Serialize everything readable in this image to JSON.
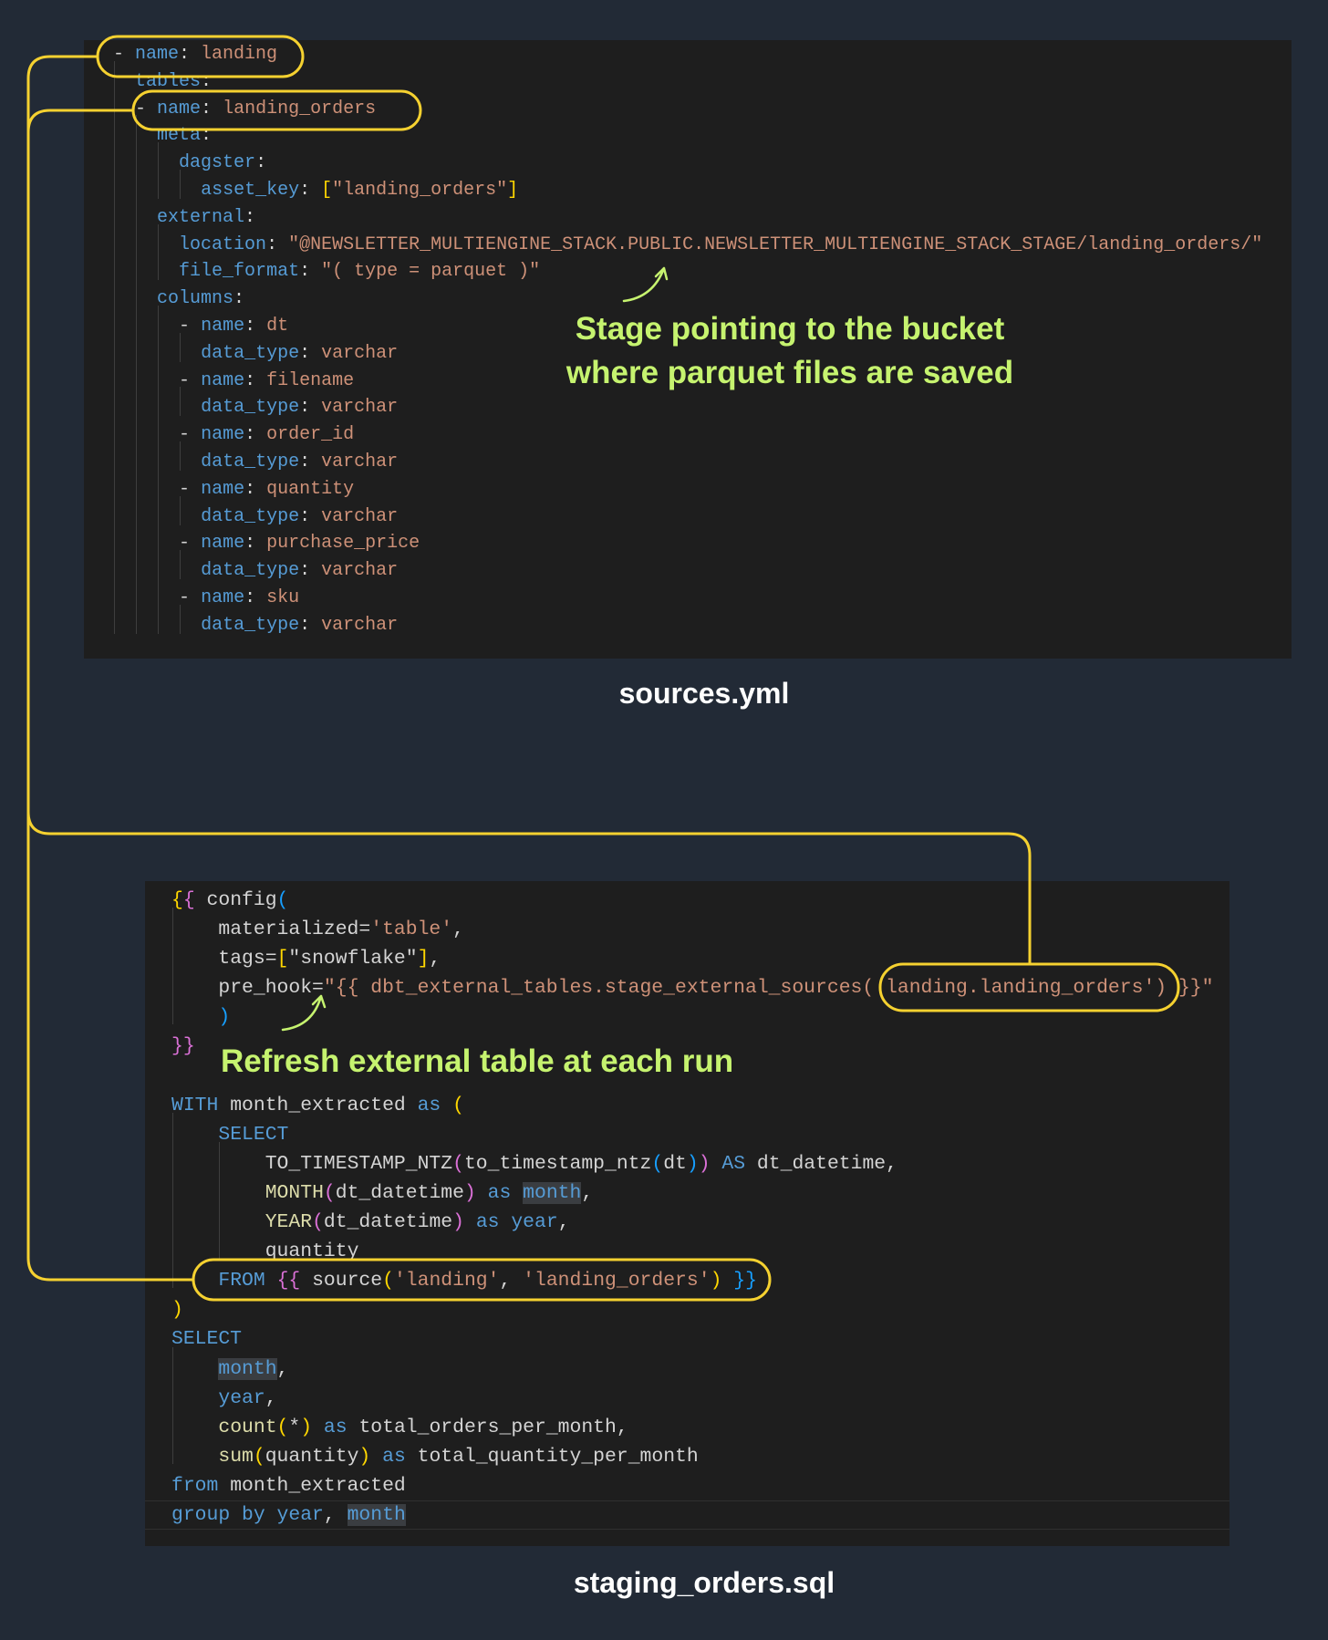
{
  "sources_yml": {
    "caption": "sources.yml",
    "annotation_line1": "Stage pointing to the bucket",
    "annotation_line2": "where parquet files are saved",
    "lines": [
      {
        "indent": 0,
        "t": [
          [
            "- ",
            "w"
          ],
          [
            "name",
            "k"
          ],
          [
            ": ",
            "w"
          ],
          [
            "landing",
            "s"
          ]
        ]
      },
      {
        "indent": 2,
        "t": [
          [
            "tables",
            "k"
          ],
          [
            ":",
            "w"
          ]
        ]
      },
      {
        "indent": 2,
        "t": [
          [
            "- ",
            "w"
          ],
          [
            "name",
            "k"
          ],
          [
            ": ",
            "w"
          ],
          [
            "landing_orders",
            "s"
          ]
        ]
      },
      {
        "indent": 4,
        "t": [
          [
            "meta",
            "k"
          ],
          [
            ":",
            "w"
          ]
        ]
      },
      {
        "indent": 6,
        "t": [
          [
            "dagster",
            "k"
          ],
          [
            ":",
            "w"
          ]
        ]
      },
      {
        "indent": 8,
        "t": [
          [
            "asset_key",
            "k"
          ],
          [
            ": ",
            "w"
          ],
          [
            "[",
            "y"
          ],
          [
            "\"landing_orders\"",
            "s"
          ],
          [
            "]",
            "y"
          ]
        ]
      },
      {
        "indent": 4,
        "t": [
          [
            "external",
            "k"
          ],
          [
            ":",
            "w"
          ]
        ]
      },
      {
        "indent": 6,
        "t": [
          [
            "location",
            "k"
          ],
          [
            ": ",
            "w"
          ],
          [
            "\"@NEWSLETTER_MULTIENGINE_STACK.PUBLIC.NEWSLETTER_MULTIENGINE_STACK_STAGE/landing_orders/\"",
            "s"
          ]
        ]
      },
      {
        "indent": 6,
        "t": [
          [
            "file_format",
            "k"
          ],
          [
            ": ",
            "w"
          ],
          [
            "\"( type = parquet )\"",
            "s"
          ]
        ]
      },
      {
        "indent": 4,
        "t": [
          [
            "columns",
            "k"
          ],
          [
            ":",
            "w"
          ]
        ]
      },
      {
        "indent": 6,
        "t": [
          [
            "- ",
            "w"
          ],
          [
            "name",
            "k"
          ],
          [
            ": ",
            "w"
          ],
          [
            "dt",
            "s"
          ]
        ]
      },
      {
        "indent": 8,
        "t": [
          [
            "data_type",
            "k"
          ],
          [
            ": ",
            "w"
          ],
          [
            "varchar",
            "s"
          ]
        ]
      },
      {
        "indent": 6,
        "t": [
          [
            "- ",
            "w"
          ],
          [
            "name",
            "k"
          ],
          [
            ": ",
            "w"
          ],
          [
            "filename",
            "s"
          ]
        ]
      },
      {
        "indent": 8,
        "t": [
          [
            "data_type",
            "k"
          ],
          [
            ": ",
            "w"
          ],
          [
            "varchar",
            "s"
          ]
        ]
      },
      {
        "indent": 6,
        "t": [
          [
            "- ",
            "w"
          ],
          [
            "name",
            "k"
          ],
          [
            ": ",
            "w"
          ],
          [
            "order_id",
            "s"
          ]
        ]
      },
      {
        "indent": 8,
        "t": [
          [
            "data_type",
            "k"
          ],
          [
            ": ",
            "w"
          ],
          [
            "varchar",
            "s"
          ]
        ]
      },
      {
        "indent": 6,
        "t": [
          [
            "- ",
            "w"
          ],
          [
            "name",
            "k"
          ],
          [
            ": ",
            "w"
          ],
          [
            "quantity",
            "s"
          ]
        ]
      },
      {
        "indent": 8,
        "t": [
          [
            "data_type",
            "k"
          ],
          [
            ": ",
            "w"
          ],
          [
            "varchar",
            "s"
          ]
        ]
      },
      {
        "indent": 6,
        "t": [
          [
            "- ",
            "w"
          ],
          [
            "name",
            "k"
          ],
          [
            ": ",
            "w"
          ],
          [
            "purchase_price",
            "s"
          ]
        ]
      },
      {
        "indent": 8,
        "t": [
          [
            "data_type",
            "k"
          ],
          [
            ": ",
            "w"
          ],
          [
            "varchar",
            "s"
          ]
        ]
      },
      {
        "indent": 6,
        "t": [
          [
            "- ",
            "w"
          ],
          [
            "name",
            "k"
          ],
          [
            ": ",
            "w"
          ],
          [
            "sku",
            "s"
          ]
        ]
      },
      {
        "indent": 8,
        "t": [
          [
            "data_type",
            "k"
          ],
          [
            ": ",
            "w"
          ],
          [
            "varchar",
            "s"
          ]
        ]
      }
    ]
  },
  "staging_orders_sql": {
    "caption": "staging_orders.sql",
    "annotation": "Refresh external table at each run",
    "lines": [
      {
        "indent": 0,
        "t": [
          [
            "{",
            "y"
          ],
          [
            "{",
            "p"
          ],
          [
            " config",
            "w"
          ],
          [
            "(",
            "b"
          ]
        ]
      },
      {
        "indent": 4,
        "t": [
          [
            "materialized=",
            "w"
          ],
          [
            "'table'",
            "s"
          ],
          [
            ",",
            "w"
          ]
        ]
      },
      {
        "indent": 4,
        "t": [
          [
            "tags=",
            "w"
          ],
          [
            "[",
            "y"
          ],
          [
            "\"snowflake\"",
            "w"
          ],
          [
            "]",
            "y"
          ],
          [
            ",",
            "w"
          ]
        ]
      },
      {
        "indent": 4,
        "t": [
          [
            "pre_hook=",
            "w"
          ],
          [
            "\"{{ dbt_external_tables.stage_external_sources( landing.landing_orders') }}\"",
            "s"
          ]
        ]
      },
      {
        "indent": 4,
        "t": [
          [
            ")",
            "b"
          ]
        ]
      },
      {
        "indent": 0,
        "t": [
          [
            "}}",
            "p"
          ]
        ]
      },
      {
        "indent": 0,
        "t": []
      },
      {
        "indent": 0,
        "t": [
          [
            "WITH",
            "k"
          ],
          [
            " month_extracted ",
            "w"
          ],
          [
            "as",
            "k"
          ],
          [
            " ",
            "w"
          ],
          [
            "(",
            "y"
          ]
        ]
      },
      {
        "indent": 4,
        "t": [
          [
            "SELECT",
            "k"
          ]
        ]
      },
      {
        "indent": 8,
        "t": [
          [
            "TO_TIMESTAMP_NTZ",
            "w"
          ],
          [
            "(",
            "p"
          ],
          [
            "to_timestamp_ntz",
            "w"
          ],
          [
            "(",
            "b"
          ],
          [
            "dt",
            "w"
          ],
          [
            ")",
            "b"
          ],
          [
            ")",
            "p"
          ],
          [
            " ",
            "w"
          ],
          [
            "AS",
            "k"
          ],
          [
            " dt_datetime,",
            "w"
          ]
        ]
      },
      {
        "indent": 8,
        "t": [
          [
            "MONTH",
            "f"
          ],
          [
            "(",
            "p"
          ],
          [
            "dt_datetime",
            "w"
          ],
          [
            ")",
            "p"
          ],
          [
            " ",
            "w"
          ],
          [
            "as",
            "k"
          ],
          [
            " ",
            "w"
          ],
          [
            "month",
            "sel"
          ],
          [
            ",",
            "w"
          ]
        ]
      },
      {
        "indent": 8,
        "t": [
          [
            "YEAR",
            "f"
          ],
          [
            "(",
            "p"
          ],
          [
            "dt_datetime",
            "w"
          ],
          [
            ")",
            "p"
          ],
          [
            " ",
            "w"
          ],
          [
            "as",
            "k"
          ],
          [
            " ",
            "w"
          ],
          [
            "year",
            "k"
          ],
          [
            ",",
            "w"
          ]
        ]
      },
      {
        "indent": 8,
        "t": [
          [
            "quantity",
            "w"
          ]
        ]
      },
      {
        "indent": 4,
        "t": [
          [
            "FROM",
            "k"
          ],
          [
            " ",
            "w"
          ],
          [
            "{{",
            "p"
          ],
          [
            " source",
            "w"
          ],
          [
            "(",
            "y"
          ],
          [
            "'landing'",
            "s"
          ],
          [
            ", ",
            "w"
          ],
          [
            "'landing_orders'",
            "s"
          ],
          [
            ")",
            "y"
          ],
          [
            " ",
            "w"
          ],
          [
            "}}",
            "b"
          ]
        ]
      },
      {
        "indent": 0,
        "t": [
          [
            ")",
            "y"
          ]
        ]
      },
      {
        "indent": 0,
        "t": [
          [
            "SELECT",
            "k"
          ]
        ]
      },
      {
        "indent": 4,
        "t": [
          [
            "month",
            "sel"
          ],
          [
            ",",
            "w"
          ]
        ]
      },
      {
        "indent": 4,
        "t": [
          [
            "year",
            "k"
          ],
          [
            ",",
            "w"
          ]
        ]
      },
      {
        "indent": 4,
        "t": [
          [
            "count",
            "f"
          ],
          [
            "(",
            "y"
          ],
          [
            "*",
            "w"
          ],
          [
            ")",
            "y"
          ],
          [
            " ",
            "w"
          ],
          [
            "as",
            "k"
          ],
          [
            " total_orders_per_month,",
            "w"
          ]
        ]
      },
      {
        "indent": 4,
        "t": [
          [
            "sum",
            "f"
          ],
          [
            "(",
            "y"
          ],
          [
            "quantity",
            "w"
          ],
          [
            ")",
            "y"
          ],
          [
            " ",
            "w"
          ],
          [
            "as",
            "k"
          ],
          [
            " total_quantity_per_month",
            "w"
          ]
        ]
      },
      {
        "indent": 0,
        "t": [
          [
            "from",
            "k"
          ],
          [
            " month_extracted",
            "w"
          ]
        ]
      },
      {
        "indent": 0,
        "current": true,
        "t": [
          [
            "group by",
            "k"
          ],
          [
            " ",
            "w"
          ],
          [
            "year",
            "k"
          ],
          [
            ", ",
            "w"
          ],
          [
            "month",
            "sel"
          ]
        ]
      }
    ]
  },
  "colors": {
    "highlight": "#f5d130",
    "annotation": "#c6f36f",
    "background": "#222a36",
    "editor": "#1e1e1e"
  }
}
